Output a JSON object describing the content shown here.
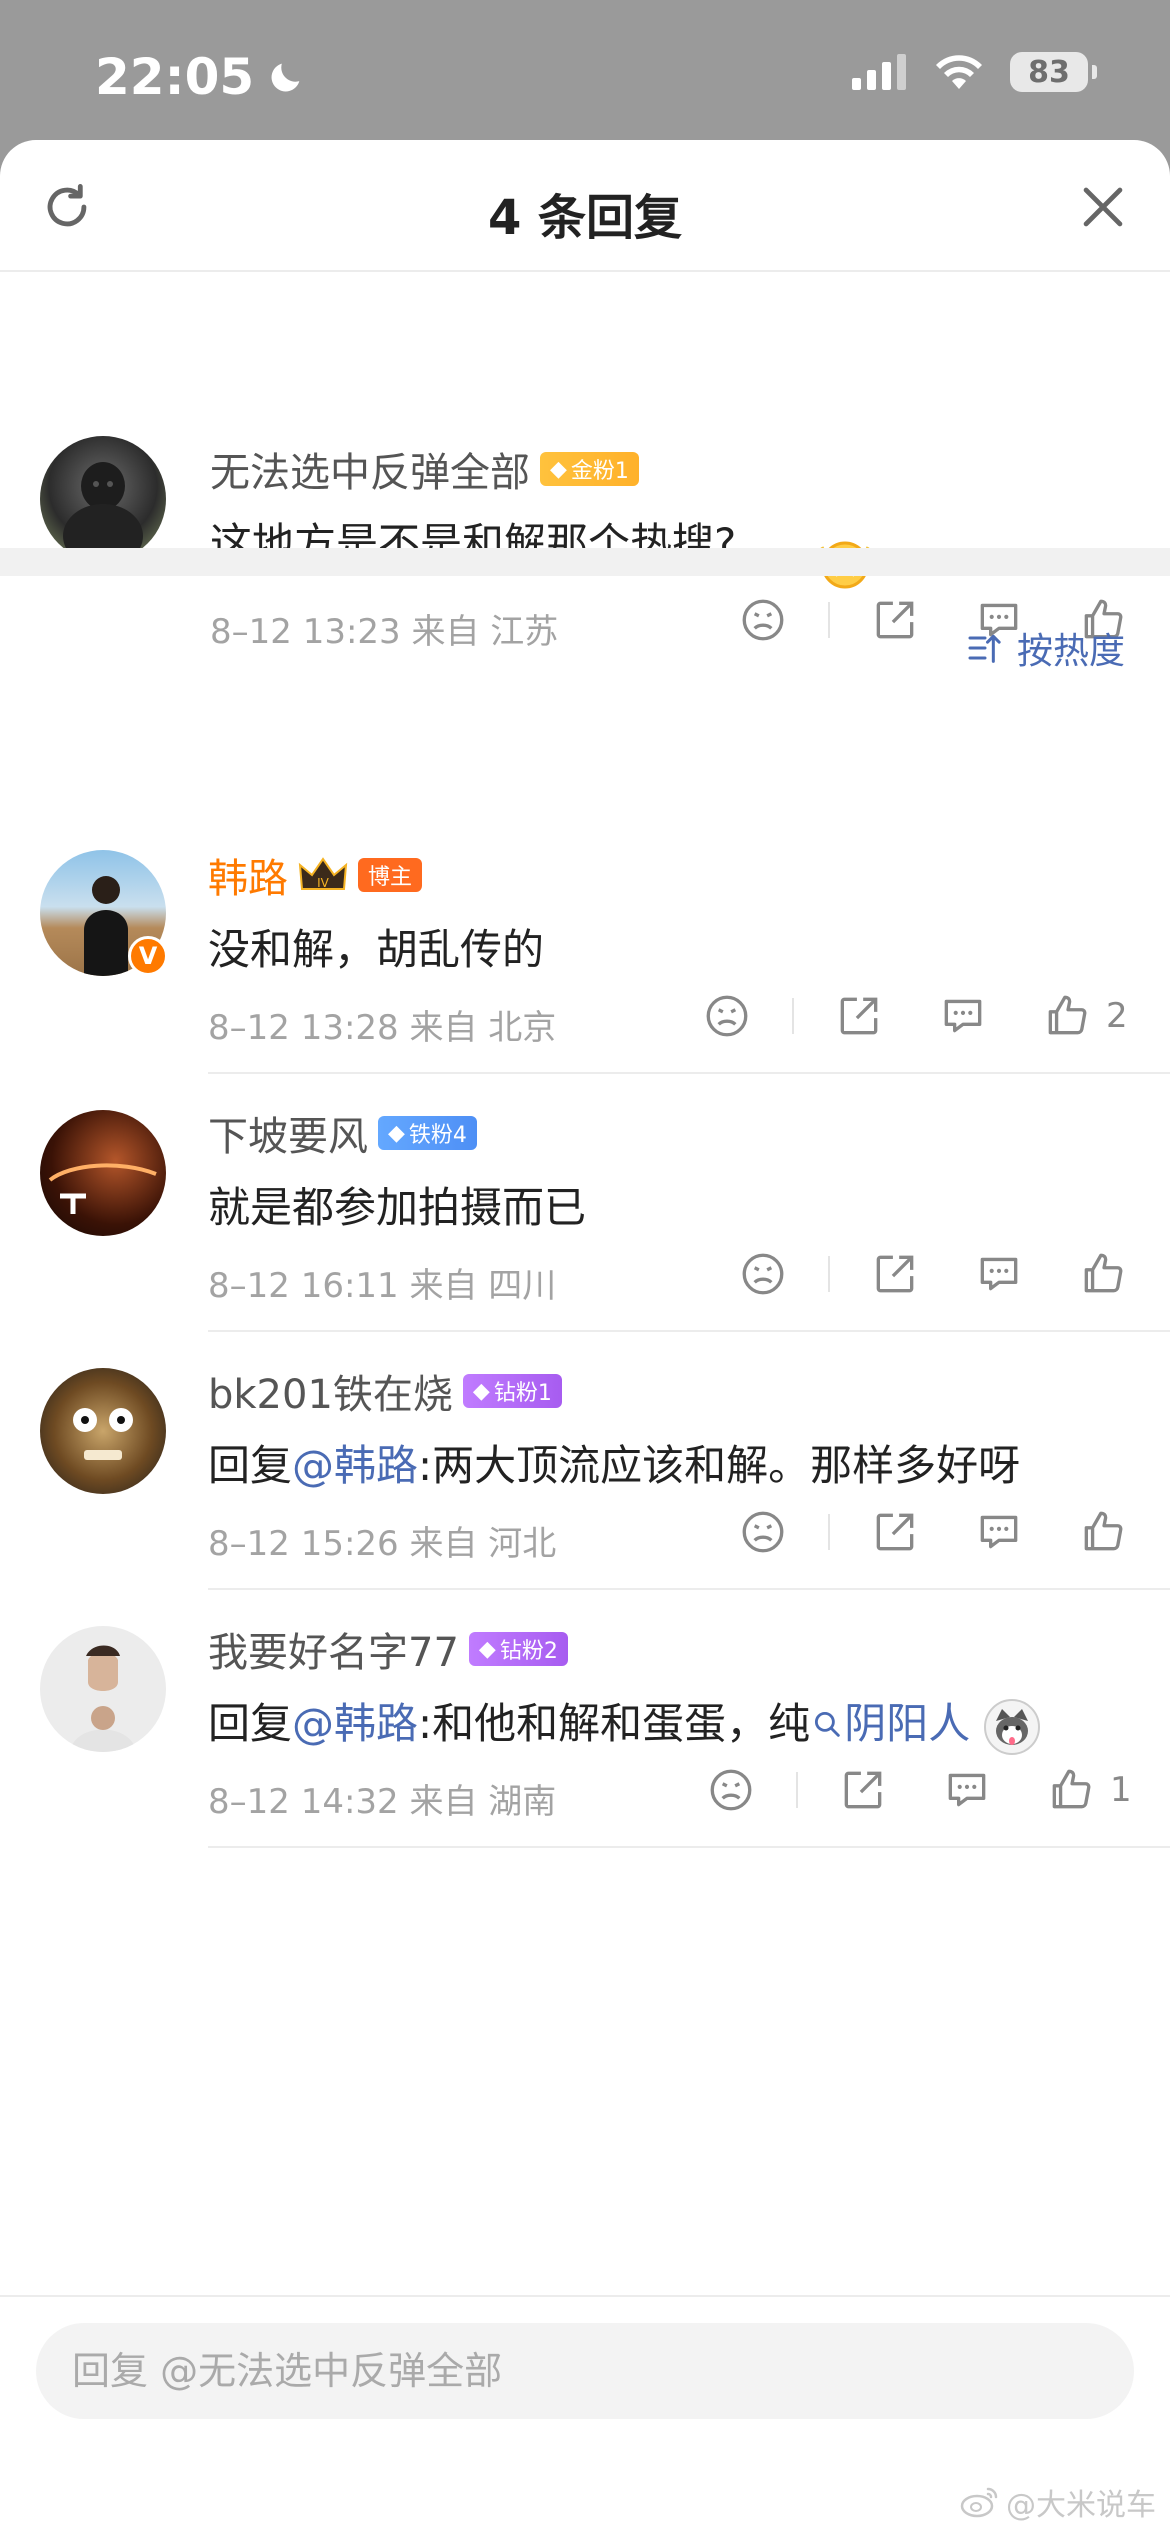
{
  "status": {
    "time": "22:05",
    "battery": "83"
  },
  "header": {
    "title": "4 条回复"
  },
  "root": {
    "username": "无法选中反弹全部",
    "badge": "金粉1",
    "text": "这地方是不是和解那个热搜?",
    "meta": "8–12 13:23  来自 江苏"
  },
  "sort": {
    "label": "按热度"
  },
  "replies": [
    {
      "username": "韩路",
      "badge": "博主",
      "text": "没和解，胡乱传的",
      "meta": "8–12 13:28  来自 北京",
      "likes": "2"
    },
    {
      "username": "下坡要风",
      "badge": "铁粉4",
      "text": "就是都参加拍摄而已",
      "meta": "8–12 16:11  来自 四川",
      "likes": ""
    },
    {
      "username": "bk201铁在烧",
      "badge": "钻粉1",
      "prefix": "回复",
      "mention": "@韩路",
      "text": ":两大顶流应该和解。那样多好呀",
      "meta": "8–12 15:26  来自 河北",
      "likes": ""
    },
    {
      "username": "我要好名字77",
      "badge": "钻粉2",
      "prefix": "回复",
      "mention": "@韩路",
      "text": ":和他和解和蛋蛋，纯",
      "topic": "阴阳人",
      "meta": "8–12 14:32  来自 湖南",
      "likes": "1"
    }
  ],
  "reply_box": {
    "placeholder": "回复 @无法选中反弹全部"
  },
  "watermark": "@大米说车",
  "colors": {
    "accent": "#4a6bb4",
    "blogger": "#ff7a00"
  }
}
